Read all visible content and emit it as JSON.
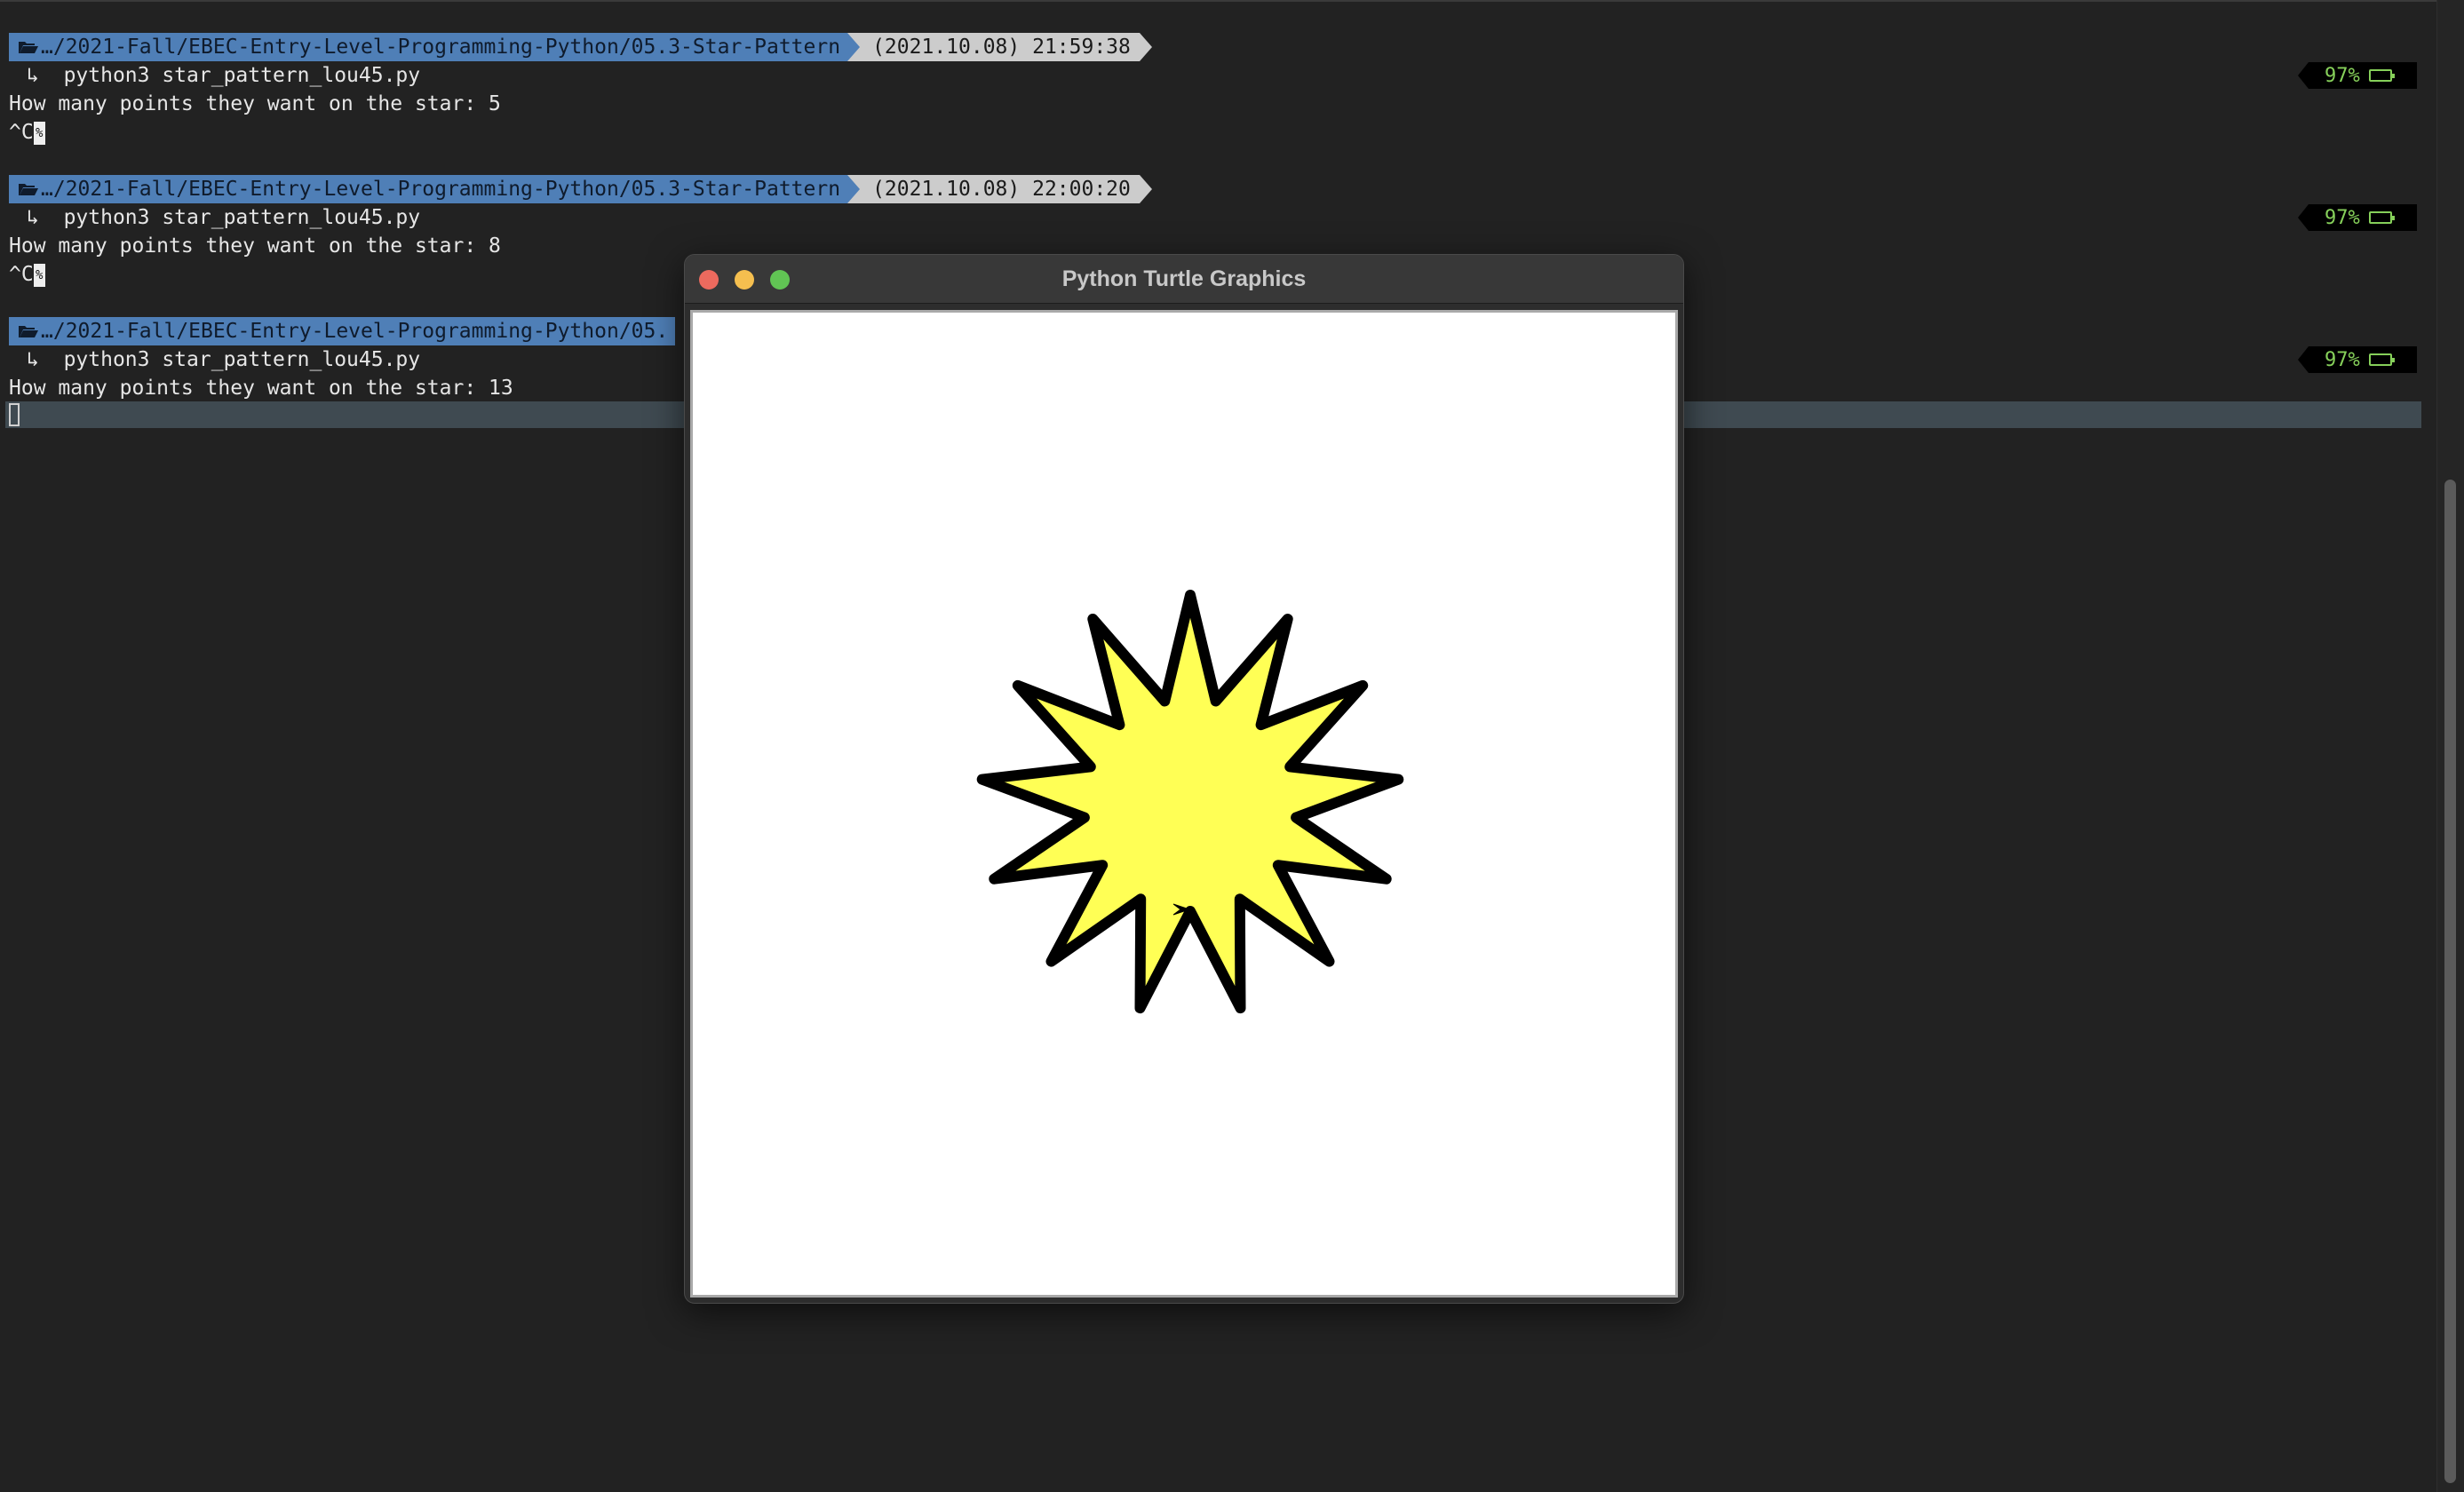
{
  "terminal": {
    "sessions": [
      {
        "path": "…/2021-Fall/EBEC-Entry-Level-Programming-Python/05.3-Star-Pattern",
        "timestamp": "(2021.10.08) 21:59:38",
        "command_arrow": "↳",
        "command": "python3 star_pattern_lou45.py",
        "output": "How many points they want on the star: 5",
        "interrupt": "^C",
        "interrupt_marker": "%",
        "battery": "97%"
      },
      {
        "path": "…/2021-Fall/EBEC-Entry-Level-Programming-Python/05.3-Star-Pattern",
        "timestamp": "(2021.10.08) 22:00:20",
        "command_arrow": "↳",
        "command": "python3 star_pattern_lou45.py",
        "output": "How many points they want on the star: 8",
        "interrupt": "^C",
        "interrupt_marker": "%",
        "battery": "97%"
      },
      {
        "path": "…/2021-Fall/EBEC-Entry-Level-Programming-Python/05.",
        "command_arrow": "↳",
        "command": "python3 star_pattern_lou45.py",
        "output": "How many points they want on the star: 13",
        "battery": "97%"
      }
    ]
  },
  "turtle_window": {
    "title": "Python Turtle Graphics",
    "star": {
      "points": 13,
      "fill_color": "#ffff55",
      "outline_color": "#000000"
    }
  },
  "colors": {
    "background": "#222222",
    "path_segment": "#4f7fb7",
    "time_segment": "#cccccc",
    "battery_text": "#86d05a",
    "active_line": "#3f4a51"
  },
  "icons": {
    "folder": "folder-open-icon",
    "battery": "battery-icon",
    "turtle": "turtle-cursor-icon"
  }
}
